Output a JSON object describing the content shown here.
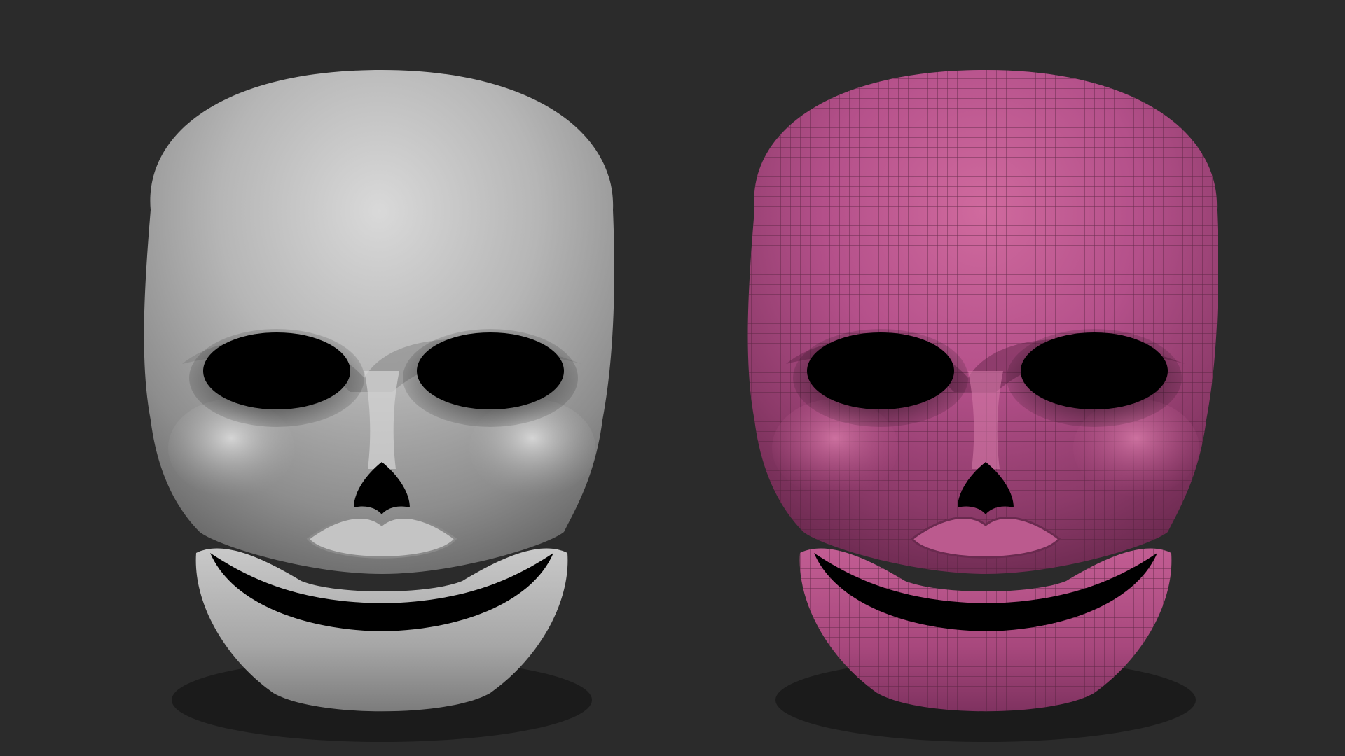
{
  "scene": {
    "background_color": "#2b2b2b",
    "models": [
      {
        "name": "smooth-shaded-skull-mask",
        "material_color": "#bdbdbd",
        "wireframe": false
      },
      {
        "name": "polyframe-skull-mask",
        "material_color": "#b34d83",
        "wireframe": true,
        "wire_color": "#4d2038"
      }
    ]
  }
}
